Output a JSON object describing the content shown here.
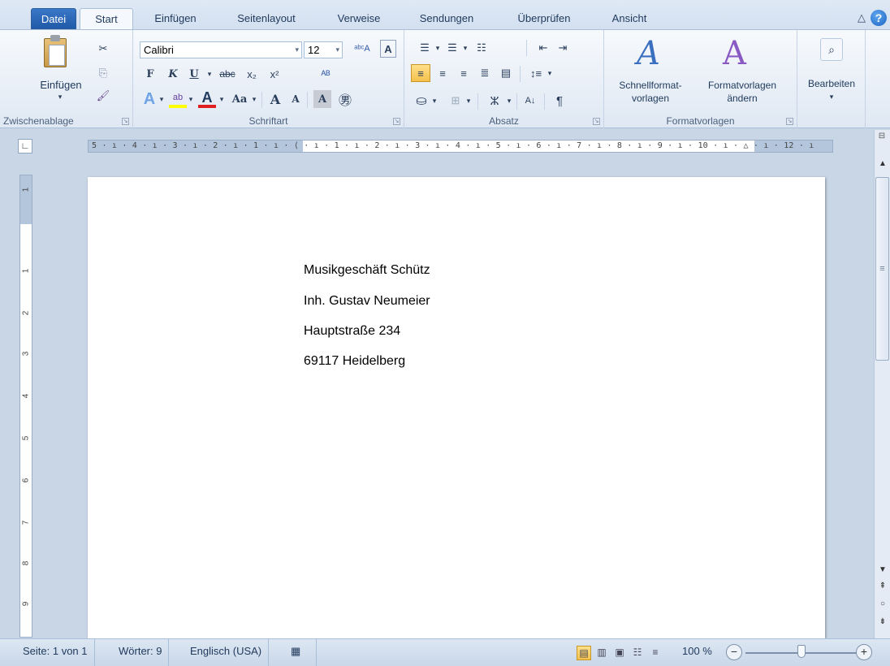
{
  "tabs": [
    "Datei",
    "Start",
    "Einfügen",
    "Seitenlayout",
    "Verweise",
    "Sendungen",
    "Überprüfen",
    "Ansicht"
  ],
  "ribbon": {
    "clipboard": {
      "paste_label": "Einfügen",
      "group_label": "Zwischenablage"
    },
    "font": {
      "family": "Calibri",
      "size": "12",
      "bold": "F",
      "italic": "K",
      "underline": "U",
      "strike": "abc",
      "subscript": "x₂",
      "superscript": "x²",
      "grow": "A",
      "shrink": "A",
      "case": "Aa",
      "group_label": "Schriftart"
    },
    "paragraph": {
      "group_label": "Absatz"
    },
    "styles": {
      "quick_label_1": "Schnellformat-",
      "quick_label_2": "vorlagen",
      "change_label_1": "Formatvorlagen",
      "change_label_2": "ändern",
      "group_label": "Formatvorlagen"
    },
    "editing": {
      "label": "Bearbeiten"
    }
  },
  "ruler": {
    "text": "5 · ı · 4 · ı · 3 · ı · 2 · ı · 1 · ı · ⟨ · ı · 1 · ı · 2 · ı · 3 · ı · 4 · ı · 5 · ı · 6 · ı · 7 · ı · 8 · ı · 9 · ı · 10 · ı · △ · ı · 12 · ı",
    "vertical_numbers": [
      "1",
      "1",
      "2",
      "3",
      "4",
      "5",
      "6",
      "7",
      "8",
      "9"
    ]
  },
  "document": {
    "lines": [
      "Musikgeschäft Schütz",
      "Inh. Gustav Neumeier",
      "Hauptstraße 234",
      "69117 Heidelberg"
    ]
  },
  "status": {
    "page": "Seite: 1 von 1",
    "words": "Wörter: 9",
    "language": "Englisch (USA)",
    "zoom": "100 %",
    "zoom_percent": 100
  },
  "colors": {
    "file_tab": "#2b6cc4",
    "ribbon_bg": "#dfe8f3",
    "page": "#ffffff",
    "workspace": "#c9d6e6"
  },
  "icons": [
    "cut-icon",
    "copy-icon",
    "format-painter-icon",
    "paste-icon",
    "bullets-icon",
    "numbering-icon",
    "multilevel-icon",
    "decrease-indent-icon",
    "increase-indent-icon",
    "align-left-icon",
    "center-icon",
    "align-right-icon",
    "justify-icon",
    "line-spacing-icon",
    "shading-icon",
    "borders-icon",
    "sort-icon",
    "pilcrow-icon",
    "find-icon",
    "help-icon",
    "minimize-ribbon-icon"
  ]
}
